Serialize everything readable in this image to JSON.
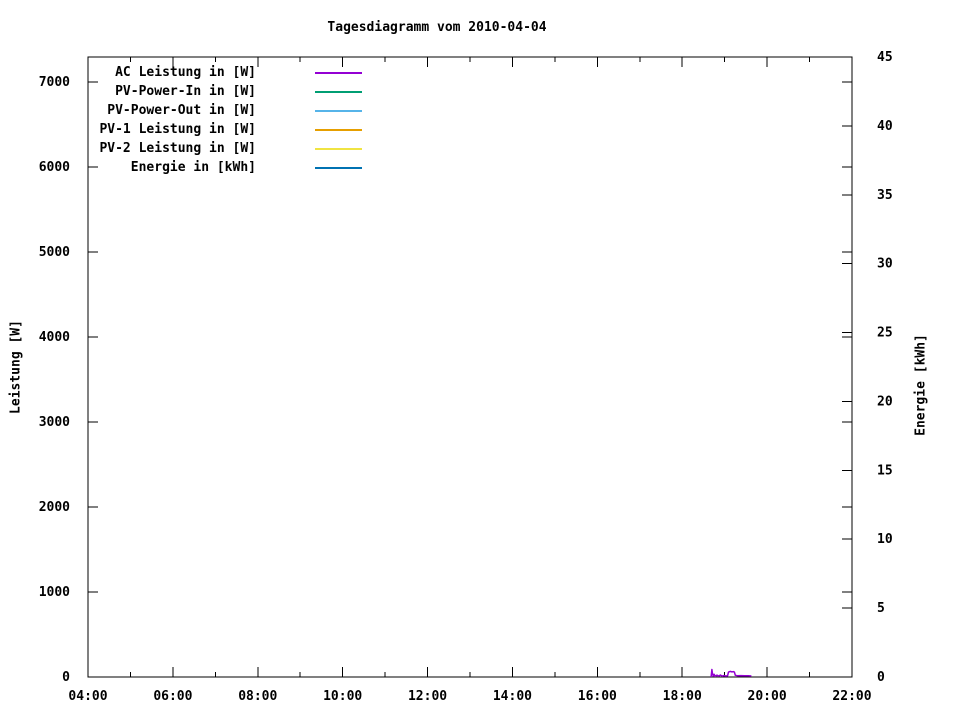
{
  "chart_data": {
    "type": "line",
    "title": "Tagesdiagramm vom 2010-04-04",
    "ylabel": "Leistung [W]",
    "y2label": "Energie [kWh]",
    "grid": false,
    "legend_position": "top-left-inside",
    "background_color": "#ffffff",
    "axis_color": "#000000",
    "x_axis": {
      "unit": "time-of-day",
      "start_hour": 4,
      "end_hour": 22,
      "major_ticks": [
        {
          "hour": 4,
          "label": "04:00"
        },
        {
          "hour": 6,
          "label": "06:00"
        },
        {
          "hour": 8,
          "label": "08:00"
        },
        {
          "hour": 10,
          "label": "10:00"
        },
        {
          "hour": 12,
          "label": "12:00"
        },
        {
          "hour": 14,
          "label": "14:00"
        },
        {
          "hour": 16,
          "label": "16:00"
        },
        {
          "hour": 18,
          "label": "18:00"
        },
        {
          "hour": 20,
          "label": "20:00"
        },
        {
          "hour": 22,
          "label": "22:00"
        }
      ],
      "minor_tick_hours": [
        5,
        7,
        9,
        11,
        13,
        15,
        17,
        19,
        21
      ]
    },
    "y_axis": {
      "label": "Leistung [W]",
      "range": [
        0,
        7294
      ],
      "ticks": [
        {
          "value": 0,
          "label": "0"
        },
        {
          "value": 1000,
          "label": "1000"
        },
        {
          "value": 2000,
          "label": "2000"
        },
        {
          "value": 3000,
          "label": "3000"
        },
        {
          "value": 4000,
          "label": "4000"
        },
        {
          "value": 5000,
          "label": "5000"
        },
        {
          "value": 6000,
          "label": "6000"
        },
        {
          "value": 7000,
          "label": "7000"
        }
      ],
      "mirror_ticks_on_right": true
    },
    "y2_axis": {
      "label": "Energie [kWh]",
      "range": [
        0,
        45
      ],
      "ticks": [
        {
          "value": 0,
          "label": "0"
        },
        {
          "value": 5,
          "label": "5"
        },
        {
          "value": 10,
          "label": "10"
        },
        {
          "value": 15,
          "label": "15"
        },
        {
          "value": 20,
          "label": "20"
        },
        {
          "value": 25,
          "label": "25"
        },
        {
          "value": 30,
          "label": "30"
        },
        {
          "value": 35,
          "label": "35"
        },
        {
          "value": 40,
          "label": "40"
        },
        {
          "value": 45,
          "label": "45"
        }
      ]
    },
    "series": [
      {
        "name": "AC Leistung in [W]",
        "color": "#9400d3",
        "axis": "y1",
        "points": [
          [
            18.68,
            0
          ],
          [
            18.7,
            88
          ],
          [
            18.71,
            45
          ],
          [
            18.73,
            12
          ],
          [
            18.75,
            32
          ],
          [
            18.78,
            8
          ],
          [
            18.82,
            22
          ],
          [
            18.86,
            10
          ],
          [
            18.9,
            24
          ],
          [
            18.94,
            10
          ],
          [
            18.98,
            16
          ],
          [
            19.03,
            12
          ],
          [
            19.07,
            15
          ],
          [
            19.09,
            58
          ],
          [
            19.13,
            66
          ],
          [
            19.17,
            60
          ],
          [
            19.21,
            63
          ],
          [
            19.23,
            58
          ],
          [
            19.25,
            20
          ],
          [
            19.3,
            15
          ],
          [
            19.38,
            16
          ],
          [
            19.47,
            14
          ],
          [
            19.56,
            15
          ],
          [
            19.63,
            12
          ]
        ]
      },
      {
        "name": "PV-Power-In in [W]",
        "color": "#009e73",
        "axis": "y1",
        "points": []
      },
      {
        "name": "PV-Power-Out in [W]",
        "color": "#56b4e9",
        "axis": "y1",
        "points": []
      },
      {
        "name": "PV-1 Leistung in [W]",
        "color": "#e69f00",
        "axis": "y1",
        "points": []
      },
      {
        "name": "PV-2 Leistung in [W]",
        "color": "#f0e442",
        "axis": "y1",
        "points": []
      },
      {
        "name": "Energie in [kWh]",
        "color": "#0072b2",
        "axis": "y2",
        "points": []
      }
    ]
  }
}
